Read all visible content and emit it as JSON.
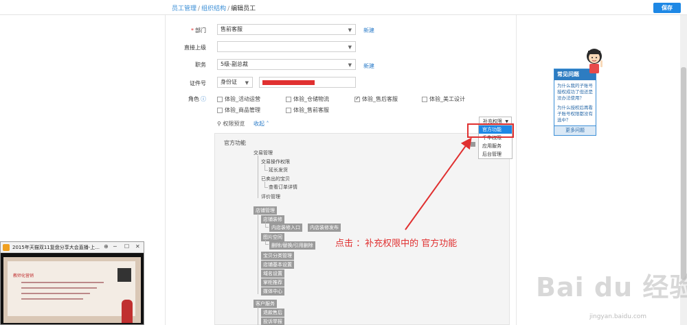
{
  "breadcrumb": {
    "item1": "员工管理",
    "sep": "/",
    "item2": "组织结构",
    "current": "编辑员工"
  },
  "toolbar": {
    "save_label": "保存"
  },
  "form": {
    "department": {
      "label": "部门",
      "required": "*",
      "value": "售前客服",
      "new_link": "新建"
    },
    "superior": {
      "label": "直接上级",
      "value": ""
    },
    "position": {
      "label": "职务",
      "value": "5级-副总裁",
      "new_link": "新建"
    },
    "id_doc": {
      "label": "证件号",
      "type_value": "身份证"
    },
    "roles": {
      "label": "角色",
      "items": [
        {
          "label": "体验_活动运营",
          "checked": false
        },
        {
          "label": "体验_仓储物流",
          "checked": false
        },
        {
          "label": "体验_售后客服",
          "checked": true
        },
        {
          "label": "体验_美工设计",
          "checked": false
        },
        {
          "label": "体验_商品管理",
          "checked": false
        },
        {
          "label": "体验_售前客服",
          "checked": false
        }
      ]
    },
    "preview": {
      "label": "权限预览",
      "toggle": "收起"
    }
  },
  "supplement": {
    "button_label": "补充权限",
    "menu": [
      "官方功能",
      "千牛权限",
      "应用服务",
      "后台管理"
    ]
  },
  "tree": {
    "root": "官方功能",
    "section1": {
      "title": "交易管理",
      "items": [
        "交易操作权限",
        "延长发货",
        "已卖出的宝贝",
        "查看订单详情",
        "评价管理"
      ]
    },
    "section2": {
      "title": "店铺管理",
      "items": [
        "店铺装修",
        "内店装修入口",
        "内店装修发布",
        "图片空间",
        "删除/替换/引用删除",
        "宝贝分类管理",
        "店铺基本设置",
        "域名设置",
        "掌柜推荐",
        "媒体中心"
      ]
    },
    "section3": {
      "title": "客户服务",
      "items": [
        "退款售后",
        "投诉举报"
      ]
    }
  },
  "help": {
    "title": "常见问题",
    "q1": "为什么我的子账号授权成功了但还是没办法使用？",
    "q2": "为什么授权后再看子账号权限都没有选中？",
    "more": "更多问题"
  },
  "video": {
    "title": "2015年天猫双11复盘分享大会直播-上...",
    "slide_title": "教师化营销"
  },
  "annotation": "点击 ：补充权限中的   官方功能",
  "watermark": {
    "logo": "Bai du 经验",
    "url": "jingyan.baidu.com"
  },
  "colors": {
    "accent": "#1e88e5",
    "annotation": "#e03030"
  }
}
